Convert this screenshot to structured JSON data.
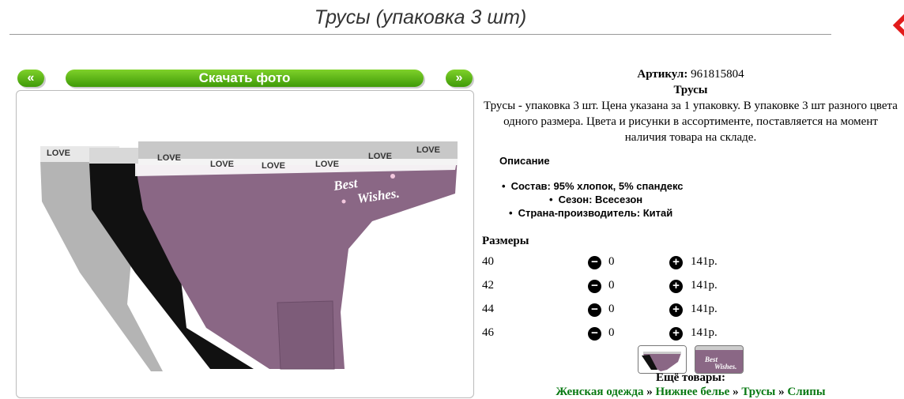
{
  "page": {
    "title": "Трусы (упаковка 3 шт)"
  },
  "gallery": {
    "prev_label": "«",
    "download_label": "Скачать фото",
    "next_label": "»",
    "photo_text": {
      "band_word": "LOVE",
      "print_line1": "Best",
      "print_line2": "Wishes."
    }
  },
  "product": {
    "article_label": "Артикул:",
    "article_value": "961815804",
    "name": "Трусы",
    "text": "Трусы - упаковка 3 шт. Цена указана за 1 упаковку. В упаковке 3 шт разного цвета одного размера. Цвета и рисунки в ассортименте, поставляется на момент наличия товара на складе.",
    "description_heading": "Описание",
    "specs": [
      "Состав: 95% хлопок, 5% спандекс",
      "Сезон: Всесезон",
      "Страна-производитель: Китай"
    ]
  },
  "sizes": {
    "heading": "Размеры",
    "rows": [
      {
        "size": "40",
        "qty": "0",
        "price": "141р."
      },
      {
        "size": "42",
        "qty": "0",
        "price": "141р."
      },
      {
        "size": "44",
        "qty": "0",
        "price": "141р."
      },
      {
        "size": "46",
        "qty": "0",
        "price": "141р."
      }
    ]
  },
  "more": {
    "heading": "Ещё товары:",
    "breadcrumbs": [
      "Женская одежда",
      "Нижнее белье",
      "Трусы",
      "Слипы"
    ],
    "separator": "»"
  },
  "colors": {
    "accent_green": "#4aa80f",
    "link_green": "#0a7a14",
    "brand_red": "#e21b1b",
    "mauve": "#8a6785",
    "grey": "#b4b4b4",
    "black": "#111111"
  },
  "icons": {
    "minus": "minus-circle-icon",
    "plus": "plus-circle-icon",
    "corner": "brand-logo-icon"
  }
}
